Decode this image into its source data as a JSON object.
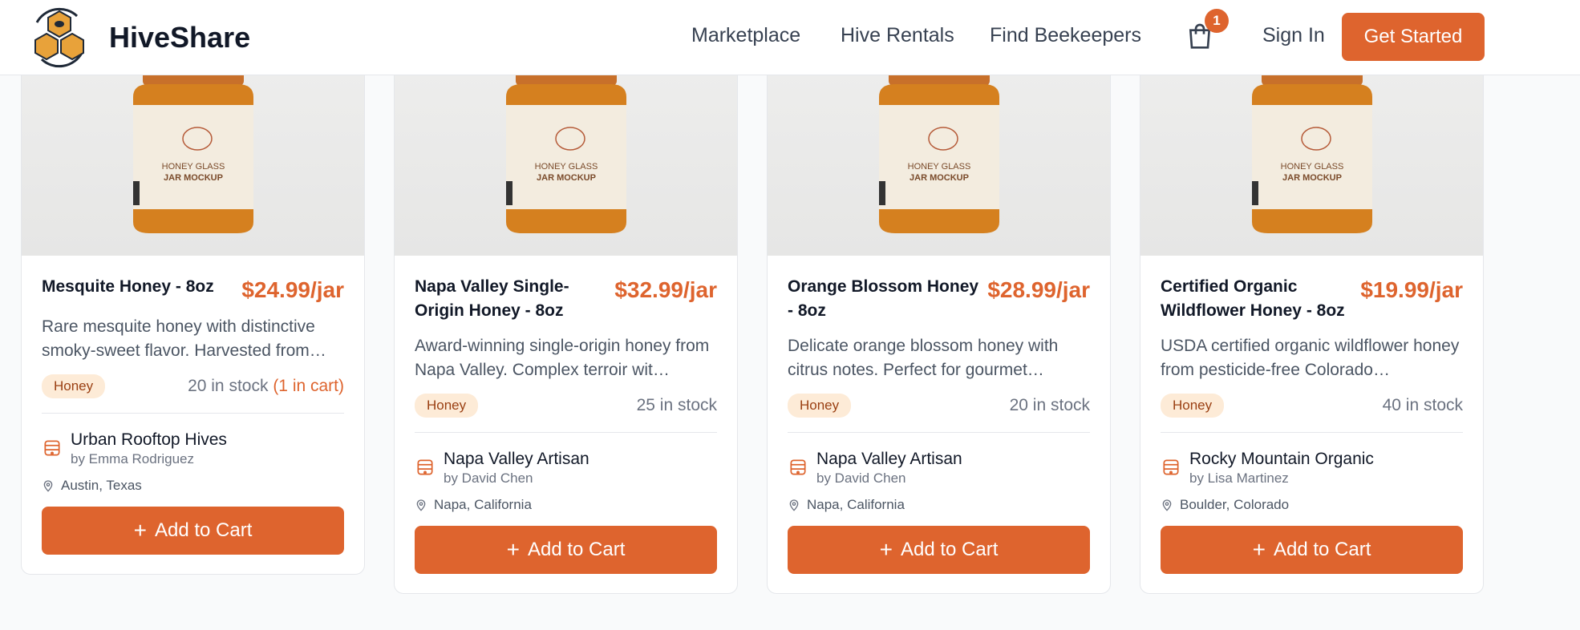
{
  "brand": {
    "name": "HiveShare",
    "logo_icon": "honeycomb-bee-logo-icon"
  },
  "nav": {
    "links": [
      "Marketplace",
      "Hive Rentals",
      "Find Beekeepers"
    ],
    "cart_badge": "1",
    "cart_icon": "shopping-bag-icon",
    "sign_in": "Sign In",
    "cta": "Get Started"
  },
  "colors": {
    "accent": "#de642e",
    "tag_bg": "#fdebd7",
    "tag_text": "#9a3f12"
  },
  "products": [
    {
      "title": "Mesquite Honey - 8oz",
      "price": "$24.99/jar",
      "description": "Rare mesquite honey with distinctive smoky-sweet flavor. Harvested from…",
      "tag": "Honey",
      "stock": "20 in stock",
      "in_cart": "(1 in cart)",
      "seller": "Urban Rooftop Hives",
      "seller_by": "by Emma Rodriguez",
      "location": "Austin, Texas",
      "button": "Add to Cart"
    },
    {
      "title": "Napa Valley Single-Origin Honey - 8oz",
      "price": "$32.99/jar",
      "description": "Award-winning single-origin honey from Napa Valley. Complex terroir wit…",
      "tag": "Honey",
      "stock": "25 in stock",
      "in_cart": "",
      "seller": "Napa Valley Artisan",
      "seller_by": "by David Chen",
      "location": "Napa, California",
      "button": "Add to Cart"
    },
    {
      "title": "Orange Blossom Honey - 8oz",
      "price": "$28.99/jar",
      "description": "Delicate orange blossom honey with citrus notes. Perfect for gourmet…",
      "tag": "Honey",
      "stock": "20 in stock",
      "in_cart": "",
      "seller": "Napa Valley Artisan",
      "seller_by": "by David Chen",
      "location": "Napa, California",
      "button": "Add to Cart"
    },
    {
      "title": "Certified Organic Wildflower Honey - 8oz",
      "price": "$19.99/jar",
      "description": "USDA certified organic wildflower honey from pesticide-free Colorado…",
      "tag": "Honey",
      "stock": "40 in stock",
      "in_cart": "",
      "seller": "Rocky Mountain Organic",
      "seller_by": "by Lisa Martinez",
      "location": "Boulder, Colorado",
      "button": "Add to Cart"
    }
  ],
  "jar_label": {
    "line1": "HONEY GLASS",
    "line2": "JAR MOCKUP"
  }
}
